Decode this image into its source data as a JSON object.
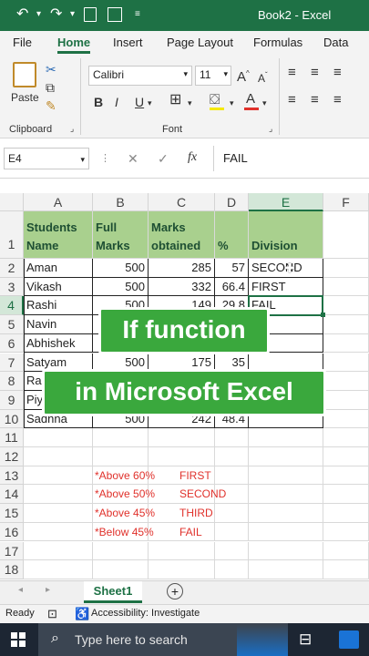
{
  "window": {
    "title": "Book2 - Excel"
  },
  "ribbon_tabs": [
    "File",
    "Home",
    "Insert",
    "Page Layout",
    "Formulas",
    "Data"
  ],
  "ribbon": {
    "paste_label": "Paste",
    "clipboard_label": "Clipboard",
    "font_name": "Calibri",
    "font_size": "11",
    "font_label": "Font",
    "bold": "B",
    "italic": "I",
    "underline": "U"
  },
  "formula_bar": {
    "name_box": "E4",
    "fx": "fx",
    "content": "FAIL"
  },
  "columns": [
    "A",
    "B",
    "C",
    "D",
    "E",
    "F"
  ],
  "rows": [
    "1",
    "2",
    "3",
    "4",
    "5",
    "6",
    "7",
    "8",
    "9",
    "10",
    "11",
    "12",
    "13",
    "14",
    "15",
    "16",
    "17",
    "18"
  ],
  "header_row": {
    "a1": "Students",
    "a2": "Name",
    "b1": "Full",
    "b2": "Marks",
    "c1": "Marks",
    "c2": "obtained",
    "d": "%",
    "e": "Division"
  },
  "data_rows": [
    {
      "name": "Aman",
      "full": "500",
      "obt": "285",
      "pct": "57",
      "div": "SECOND"
    },
    {
      "name": "Vikash",
      "full": "500",
      "obt": "332",
      "pct": "66.4",
      "div": "FIRST"
    },
    {
      "name": "Rashi",
      "full": "500",
      "obt": "149",
      "pct": "29.8",
      "div": "FAIL"
    },
    {
      "name": "Navin",
      "full": "",
      "obt": "",
      "pct": "",
      "div": ""
    },
    {
      "name": "Abhishek",
      "full": "",
      "obt": "",
      "pct": "",
      "div": ""
    },
    {
      "name": "Satyam",
      "full": "500",
      "obt": "175",
      "pct": "35",
      "div": ""
    },
    {
      "name": "Ra",
      "full": "",
      "obt": "",
      "pct": "",
      "div": ""
    },
    {
      "name": "Piy",
      "full": "",
      "obt": "",
      "pct": "",
      "div": ""
    },
    {
      "name": "Sadhna",
      "full": "500",
      "obt": "242",
      "pct": "48.4",
      "div": ""
    }
  ],
  "notes": [
    {
      "cond": "*Above 60%",
      "result": "FIRST"
    },
    {
      "cond": "*Above 50%",
      "result": "SECOND"
    },
    {
      "cond": "*Above 45%",
      "result": "THIRD"
    },
    {
      "cond": "*Below 45%",
      "result": "FAIL"
    }
  ],
  "overlays": {
    "line1": "If function",
    "line2": "in Microsoft Excel"
  },
  "sheet_tab": "Sheet1",
  "status": {
    "ready": "Ready",
    "accessibility": "Accessibility: Investigate"
  },
  "taskbar": {
    "search_placeholder": "Type here to search"
  },
  "colors": {
    "excel_green": "#1e7145",
    "header_fill": "#a9d08e",
    "note_red": "#e0312b",
    "overlay_green": "#3aa83d"
  }
}
